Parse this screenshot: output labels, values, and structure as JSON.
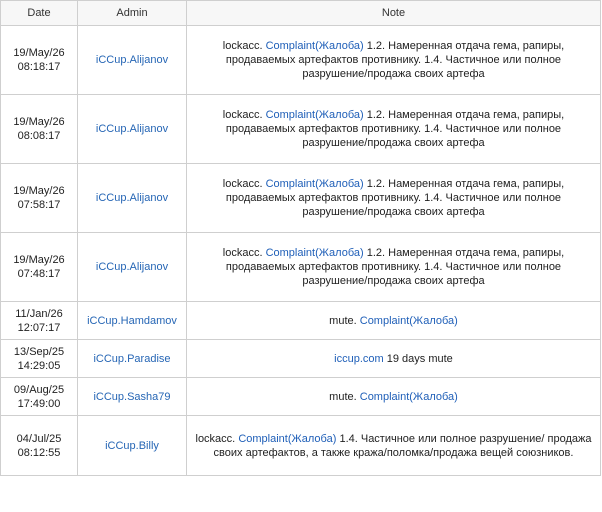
{
  "columns": {
    "date": "Date",
    "admin": "Admin",
    "note": "Note"
  },
  "rows": [
    {
      "date_line1": "19/May/26",
      "date_line2": "08:18:17",
      "admin": "iCCup.Alijanov",
      "note_prefix": "lockacc.",
      "link_text": "Complaint(Жалоба)",
      "note_suffix": "1.2. Намеренная отдача гема, рапиры, продаваемых артефактов противнику. 1.4. Частичное или полное разрушение/продажа своих артефа"
    },
    {
      "date_line1": "19/May/26",
      "date_line2": "08:08:17",
      "admin": "iCCup.Alijanov",
      "note_prefix": "lockacc.",
      "link_text": "Complaint(Жалоба)",
      "note_suffix": "1.2. Намеренная отдача гема, рапиры, продаваемых артефактов противнику. 1.4. Частичное или полное разрушение/продажа своих артефа"
    },
    {
      "date_line1": "19/May/26",
      "date_line2": "07:58:17",
      "admin": "iCCup.Alijanov",
      "note_prefix": "lockacc.",
      "link_text": "Complaint(Жалоба)",
      "note_suffix": "1.2. Намеренная отдача гема, рапиры, продаваемых артефактов противнику. 1.4. Частичное или полное разрушение/продажа своих артефа"
    },
    {
      "date_line1": "19/May/26",
      "date_line2": "07:48:17",
      "admin": "iCCup.Alijanov",
      "note_prefix": "lockacc.",
      "link_text": "Complaint(Жалоба)",
      "note_suffix": "1.2. Намеренная отдача гема, рапиры, продаваемых артефактов противнику. 1.4. Частичное или полное разрушение/продажа своих артефа"
    },
    {
      "date_line1": "11/Jan/26",
      "date_line2": "12:07:17",
      "admin": "iCCup.Hamdamov",
      "note_prefix": "mute.",
      "link_text": "Complaint(Жалоба)",
      "note_suffix": ""
    },
    {
      "date_line1": "13/Sep/25",
      "date_line2": "14:29:05",
      "admin": "iCCup.Paradise",
      "note_prefix": "",
      "link_text": "iccup.com",
      "note_suffix": "19 days mute"
    },
    {
      "date_line1": "09/Aug/25",
      "date_line2": "17:49:00",
      "admin": "iCCup.Sasha79",
      "note_prefix": "mute.",
      "link_text": "Complaint(Жалоба)",
      "note_suffix": ""
    },
    {
      "date_line1": "04/Jul/25",
      "date_line2": "08:12:55",
      "admin": "iCCup.Billy",
      "note_prefix": "lockacc.",
      "link_text": "Complaint(Жалоба)",
      "note_suffix": "1.4. Частичное или полное разрушение/ продажа своих артефактов, а также кража/поломка/продажа вещей союзников."
    }
  ],
  "colors": {
    "link": "#1f5fb8",
    "border": "#cfcfcf",
    "text": "#222222"
  }
}
